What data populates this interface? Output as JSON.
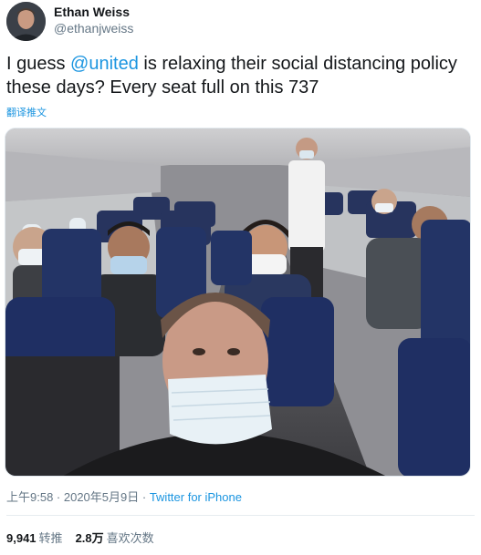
{
  "tweet": {
    "author": {
      "display_name": "Ethan Weiss",
      "handle": "@ethanjweiss"
    },
    "text_before": "I guess ",
    "mention": "@united",
    "text_after": " is relaxing their social distancing policy these days? Every seat full on this 737",
    "translate_label": "翻译推文",
    "photo_icon": "airplane-cabin-photo",
    "timestamp": "上午9:58 · 2020年5月9日",
    "separator": " · ",
    "source": "Twitter for iPhone",
    "stats": {
      "retweets_count": "9,941",
      "retweets_label": "转推",
      "likes_count": "2.8万",
      "likes_label": "喜欢次数"
    }
  },
  "colors": {
    "link": "#1b95e0",
    "muted": "#657786",
    "text": "#14171a"
  }
}
